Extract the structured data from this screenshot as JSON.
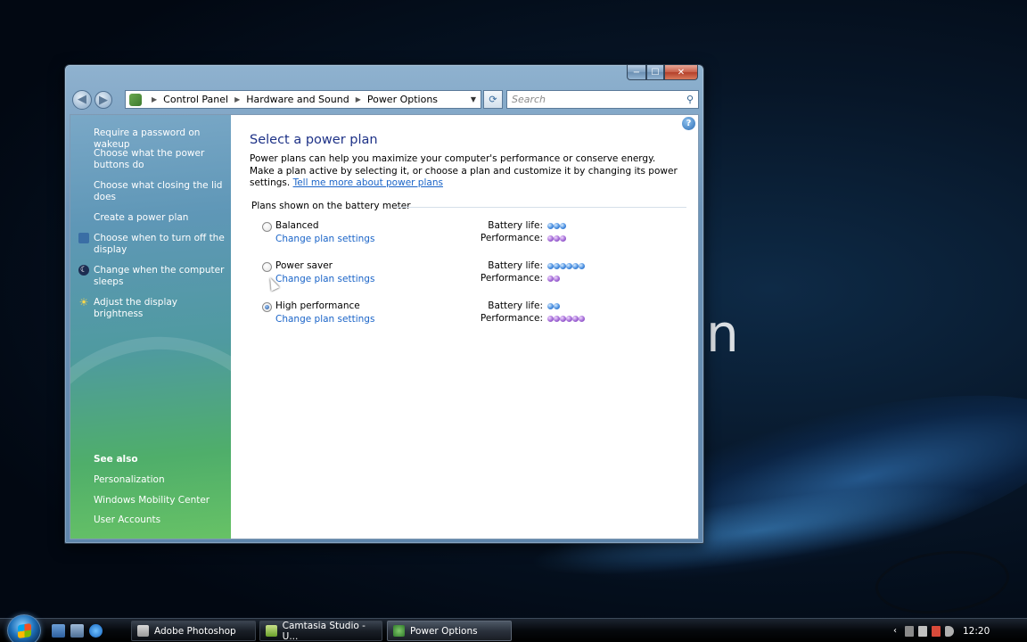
{
  "window": {
    "title_controls": {
      "minimize": "−",
      "maximize": "☐",
      "close": "✕"
    }
  },
  "address_bar": {
    "crumbs": [
      "Control Panel",
      "Hardware and Sound",
      "Power Options"
    ],
    "search_placeholder": "Search"
  },
  "left_pane": {
    "tasks": [
      {
        "label": "Require a password on wakeup",
        "icon": ""
      },
      {
        "label": "Choose what the power buttons do",
        "icon": ""
      },
      {
        "label": "Choose what closing the lid does",
        "icon": ""
      },
      {
        "label": "Create a power plan",
        "icon": ""
      },
      {
        "label": "Choose when to turn off the display",
        "icon": "monitor-icon"
      },
      {
        "label": "Change when the computer sleeps",
        "icon": "moon-icon"
      },
      {
        "label": "Adjust the display brightness",
        "icon": "sun-icon"
      }
    ],
    "see_also_heading": "See also",
    "see_also": [
      "Personalization",
      "Windows Mobility Center",
      "User Accounts"
    ]
  },
  "main": {
    "title": "Select a power plan",
    "description": "Power plans can help you maximize your computer's performance or conserve energy. Make a plan active by selecting it, or choose a plan and customize it by changing its power settings. ",
    "description_link": "Tell me more about power plans",
    "group_label": "Plans shown on the battery meter",
    "battery_label": "Battery life:",
    "performance_label": "Performance:",
    "change_link": "Change plan settings",
    "plans": [
      {
        "name": "Balanced",
        "selected": false,
        "battery_life": 3,
        "performance": 3
      },
      {
        "name": "Power saver",
        "selected": false,
        "battery_life": 6,
        "performance": 2
      },
      {
        "name": "High performance",
        "selected": true,
        "battery_life": 2,
        "performance": 6
      }
    ]
  },
  "taskbar": {
    "buttons": [
      "Adobe Photoshop",
      "Camtasia Studio - U...",
      "Power Options"
    ],
    "active_button": "Power Options",
    "clock": "12:20"
  },
  "desktop": {
    "glyph": "n"
  },
  "colors": {
    "title_blue": "#1e3287",
    "link_blue": "#1a64c8",
    "battery_dot": "#4a8fe0",
    "performance_dot": "#a26ad6"
  }
}
